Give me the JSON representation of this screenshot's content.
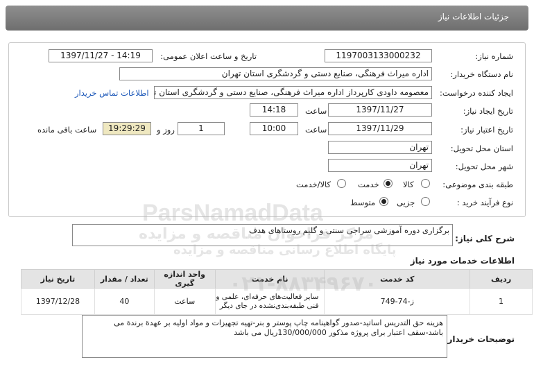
{
  "header": {
    "title": "جزئیات اطلاعات نیاز"
  },
  "form": {
    "need_number_label": "شماره نیاز:",
    "need_number": "1197003133000232",
    "announce_label": "تاریخ و ساعت اعلان عمومی:",
    "announce_value": "1397/11/27 - 14:19",
    "buyer_org_label": "نام دستگاه خریدار:",
    "buyer_org": "اداره میراث فرهنگی، صنایع دستی و گردشگری استان تهران",
    "requester_label": "ایجاد کننده درخواست:",
    "requester": "معصومه داودی کارپرداز اداره میراث فرهنگی، صنایع دستی و گردشگری استان تهران",
    "contact_link": "اطلاعات تماس خریدار",
    "created_label": "تاریخ ایجاد نیاز:",
    "created_date": "1397/11/27",
    "time_label": "ساعت",
    "created_time": "14:18",
    "validity_label": "تاریخ اعتبار نیاز:",
    "validity_date": "1397/11/29",
    "validity_time": "10:00",
    "days_value": "1",
    "days_label": "روز و",
    "remaining_value": "19:29:29",
    "remaining_label": "ساعت باقی مانده",
    "province_label": "استان محل تحویل:",
    "province": "تهران",
    "city_label": "شهر محل تحویل:",
    "city": "تهران",
    "category_label": "طبقه بندی موضوعی:",
    "category_options": [
      "کالا",
      "خدمت",
      "کالا/خدمت"
    ],
    "category_selected": "خدمت",
    "process_label": "نوع فرآیند خرید :",
    "process_options": [
      "جزیی",
      "متوسط"
    ],
    "process_selected": "متوسط"
  },
  "summary": {
    "label": "شرح کلی نیاز:",
    "text": "برگزاری دوره آموزشی سراجی سنتی و گلیم روستاهای هدف"
  },
  "services": {
    "title": "اطلاعات خدمات مورد نیاز",
    "columns": [
      "ردیف",
      "کد خدمت",
      "نام خدمت",
      "واحد اندازه گیری",
      "تعداد / مقدار",
      "تاریخ نیاز"
    ],
    "rows": [
      {
        "row": "1",
        "code": "ز-74-749",
        "name": "سایر فعالیت‌های حرفه‌ای، علمی و فنی طبقه‌بندی‌نشده در جای دیگر",
        "unit": "ساعت",
        "qty": "40",
        "date": "1397/12/28"
      }
    ]
  },
  "buyer_notes": {
    "label": "توضیحات خریدار:",
    "line1": "هزینه حق التدریس اساتید-صدور گواهینامه چاپ پوستر و بنر-تهیه تجهیزات و مواد اولیه بر عهدة برندة می",
    "line2": "باشد-سقف اعتبار برای پروژه مذکور 130/000/000ریال می باشد"
  },
  "watermark": {
    "brand": "ParsNamadData",
    "line1": "مرکز فراخوان مناقصه و مزایده",
    "line2": "پایگاه اطلاع رسانی مناقصه و مزایده",
    "phone": "۰۲۱-۸۸۳۴۹۶۷۰"
  }
}
